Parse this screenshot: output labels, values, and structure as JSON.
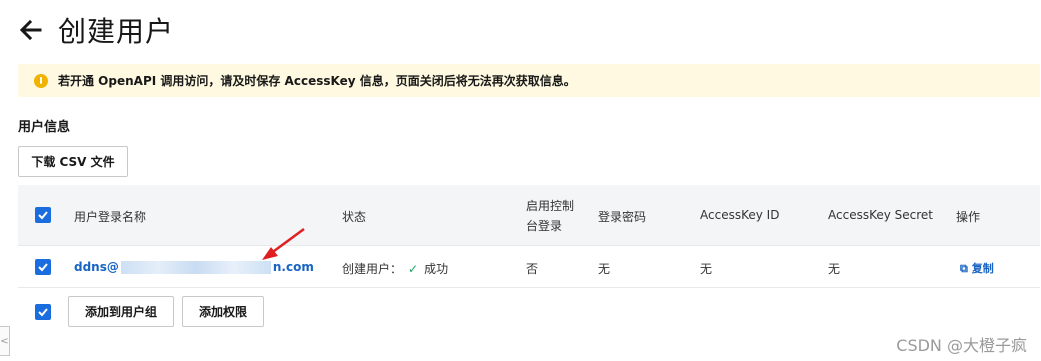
{
  "header": {
    "title": "创建用户",
    "back_icon": "arrow-left-icon"
  },
  "notice": {
    "icon": "warning-icon",
    "text": "若开通 OpenAPI 调用访问，请及时保存 AccessKey 信息，页面关闭后将无法再次获取信息。",
    "color": "#fef9e0"
  },
  "section": {
    "title": "用户信息"
  },
  "download_button": "下载 CSV 文件",
  "table": {
    "headers": {
      "login_name": "用户登录名称",
      "status": "状态",
      "console_login": "启用控制台登录",
      "password": "登录密码",
      "access_key_id": "AccessKey ID",
      "access_key_secret": "AccessKey Secret",
      "action": "操作"
    },
    "row": {
      "login_prefix": "ddns@",
      "login_suffix": "n.com",
      "status_label": "创建用户：",
      "status_value": "成功",
      "console_login": "否",
      "password": "无",
      "access_key_id": "无",
      "access_key_secret": "无",
      "copy_label": "复制"
    }
  },
  "footer": {
    "add_to_group": "添加到用户组",
    "add_permission": "添加权限"
  },
  "watermark": "CSDN @大橙子疯",
  "side_tab": "<",
  "colors": {
    "accent": "#1a6dde",
    "link": "#1764c4",
    "success": "#19a35b",
    "warning": "#f0b400",
    "annotation": "#e02020"
  }
}
